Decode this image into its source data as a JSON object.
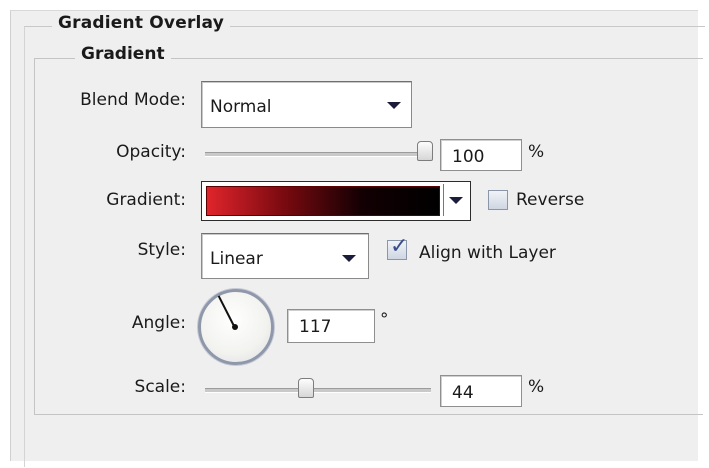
{
  "section": {
    "title": "Gradient Overlay",
    "subtitle": "Gradient"
  },
  "blend_mode": {
    "label": "Blend Mode:",
    "value": "Normal"
  },
  "opacity": {
    "label": "Opacity:",
    "value": "100",
    "unit": "%",
    "percent": 100
  },
  "gradient": {
    "label": "Gradient:",
    "colors": [
      "#e0242c",
      "#7a0a10",
      "#120003",
      "#000000"
    ],
    "reverse_label": "Reverse",
    "reverse_checked": false
  },
  "style": {
    "label": "Style:",
    "value": "Linear",
    "align_label": "Align with Layer",
    "align_checked": true
  },
  "angle": {
    "label": "Angle:",
    "value": "117",
    "unit": "°",
    "degrees": 117
  },
  "scale": {
    "label": "Scale:",
    "value": "44",
    "unit": "%",
    "percent": 44
  },
  "icons": {
    "dropdown": "chevron-down-icon",
    "angle_dial": "angle-dial-icon",
    "check": "checkmark-icon"
  }
}
